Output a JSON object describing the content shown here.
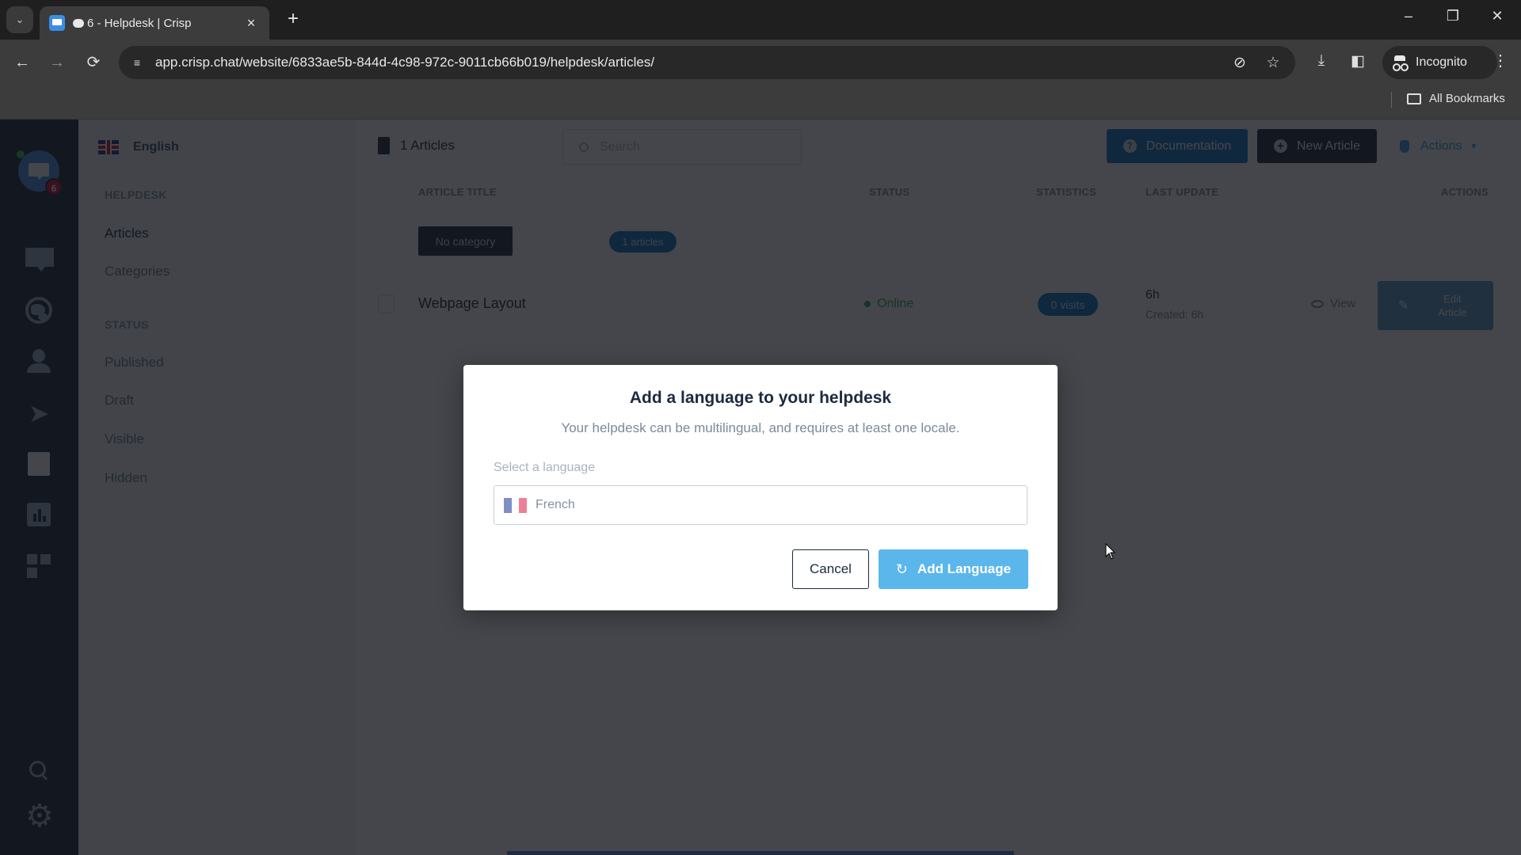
{
  "browser": {
    "tab": {
      "title": "6 - Helpdesk | Crisp",
      "close": "×"
    },
    "new_tab": "+",
    "window_controls": {
      "minimize": "–",
      "restore": "❐",
      "close": "✕"
    },
    "nav": {
      "back": "←",
      "forward": "→",
      "reload": "⟳"
    },
    "url": "app.crisp.chat/website/6833ae5b-844d-4c98-972c-9011cb66b019/helpdesk/articles/",
    "incognito_label": "Incognito",
    "menu": "⋮",
    "bookmarks": {
      "all_label": "All Bookmarks"
    }
  },
  "rail": {
    "unread_badge": "6",
    "items": [
      {
        "name": "inbox"
      },
      {
        "name": "visitors"
      },
      {
        "name": "contacts"
      },
      {
        "name": "campaigns"
      },
      {
        "name": "helpdesk",
        "active": true
      },
      {
        "name": "analytics"
      },
      {
        "name": "plugins"
      },
      {
        "name": "search"
      },
      {
        "name": "settings"
      }
    ]
  },
  "subnav": {
    "language": "English",
    "helpdesk_heading": "HELPDESK",
    "helpdesk_items": [
      {
        "label": "Articles",
        "active": true
      },
      {
        "label": "Categories"
      }
    ],
    "status_heading": "STATUS",
    "status_items": [
      {
        "label": "Published"
      },
      {
        "label": "Draft"
      },
      {
        "label": "Visible"
      },
      {
        "label": "Hidden"
      }
    ]
  },
  "main": {
    "articles_count": "1 Articles",
    "search_placeholder": "Search",
    "documentation_label": "Documentation",
    "new_article_label": "New Article",
    "actions_label": "Actions",
    "columns": {
      "title": "ARTICLE TITLE",
      "status": "STATUS",
      "statistics": "STATISTICS",
      "last_update": "LAST UPDATE",
      "actions": "ACTIONS"
    },
    "category": {
      "name": "No category",
      "count": "1 articles"
    },
    "rows": [
      {
        "title": "Webpage Layout",
        "status": "Online",
        "visits": "0 visits",
        "last_update": "6h",
        "created": "Created: 6h",
        "view_label": "View",
        "edit_label": "Edit Article"
      }
    ]
  },
  "modal": {
    "title": "Add a language to your helpdesk",
    "subtitle": "Your helpdesk can be multilingual, and requires at least one locale.",
    "field_label": "Select a language",
    "selected_language": "French",
    "cancel_label": "Cancel",
    "add_label": "Add Language"
  },
  "colors": {
    "rail_bg": "#1c2a3e",
    "brand_blue": "#4a90e2",
    "primary_button": "#5bb6ec",
    "badge_red": "#d6112f",
    "online_green": "#34a853"
  }
}
